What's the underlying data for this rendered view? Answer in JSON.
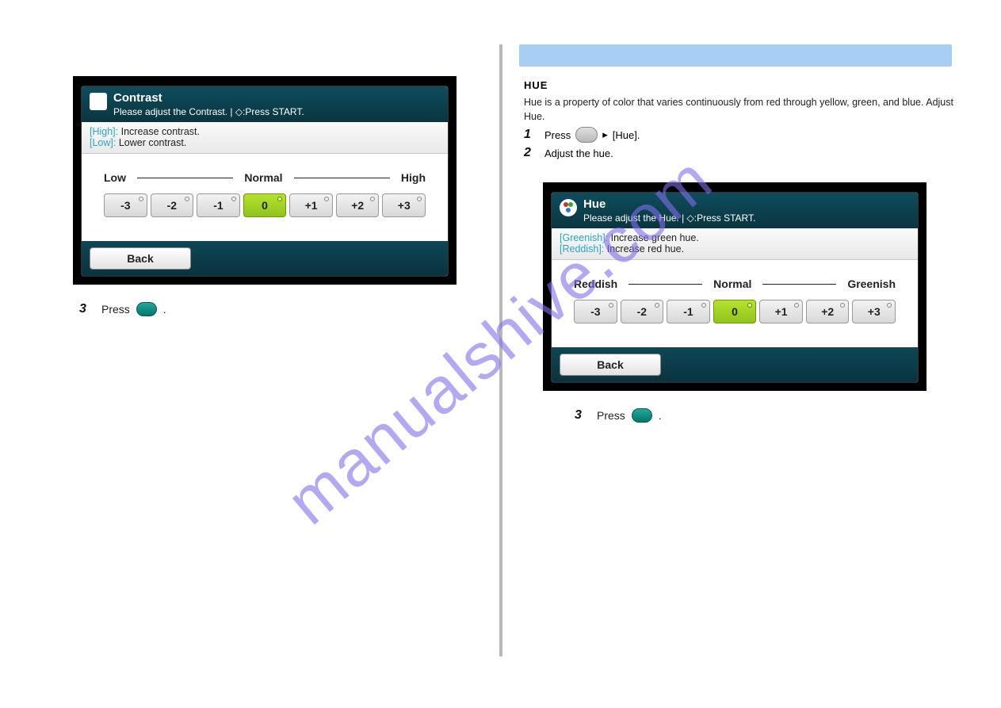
{
  "watermark": "manualshive.com",
  "left": {
    "screen": {
      "title": "Contrast",
      "subtitle": "Please adjust the Contrast. | ◇:Press START.",
      "hint_high_key": "[High]:",
      "hint_high_val": " Increase contrast.",
      "hint_low_key": "[Low]:",
      "hint_low_val": " Lower contrast.",
      "label_left": "Low",
      "label_mid": "Normal",
      "label_right": "High",
      "values": [
        "-3",
        "-2",
        "-1",
        "0",
        "+1",
        "+2",
        "+3"
      ],
      "active_index": 3,
      "back": "Back"
    },
    "step": {
      "num": "3",
      "prefix": "Press",
      "suffix": "."
    }
  },
  "right": {
    "hue_section": {
      "heading": "HUE",
      "desc": "Hue is a property of color that varies continuously from red through yellow, green, and blue. Adjust Hue.",
      "step1": {
        "num": "1",
        "prepress": "Press",
        "item": "[Hue]."
      },
      "step2": {
        "num": "2",
        "text": "Adjust the hue."
      }
    },
    "screen": {
      "title": "Hue",
      "subtitle": "Please adjust the Hue. | ◇:Press START.",
      "hint_g_key": "[Greenish]:",
      "hint_g_val": " Increase green hue.",
      "hint_r_key": "[Reddish]:",
      "hint_r_val": " Increase red hue.",
      "label_left": "Reddish",
      "label_mid": "Normal",
      "label_right": "Greenish",
      "values": [
        "-3",
        "-2",
        "-1",
        "0",
        "+1",
        "+2",
        "+3"
      ],
      "active_index": 3,
      "back": "Back"
    },
    "step3": {
      "num": "3",
      "prefix": "Press",
      "suffix": "."
    }
  }
}
